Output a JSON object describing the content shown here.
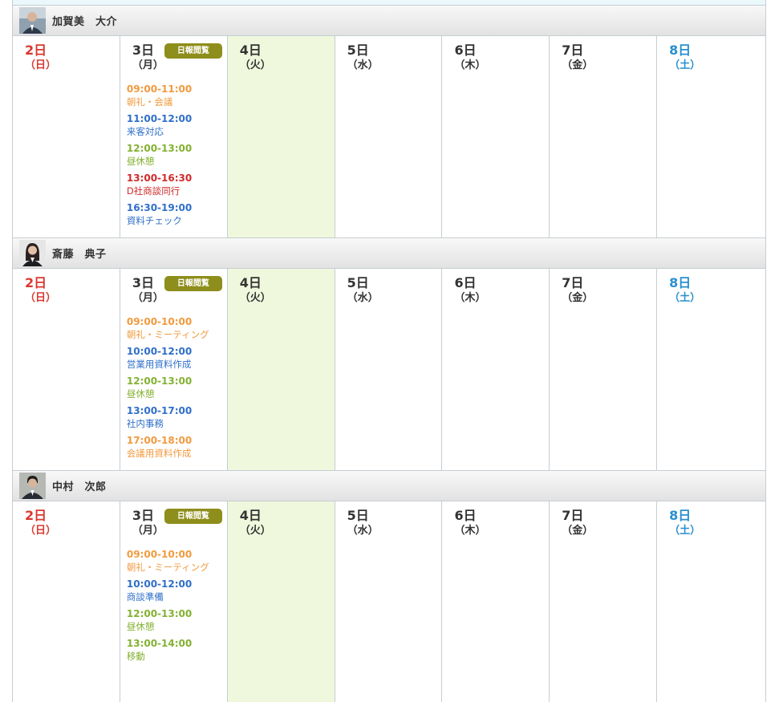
{
  "report_label": "日報閲覧",
  "colors": {
    "orange": "#f19a3e",
    "blue": "#2f6fc9",
    "green": "#84b132",
    "red": "#d12a2a",
    "today_bg": "#eff8dd",
    "sunday": "#d9382f",
    "saturday": "#2a8fcd"
  },
  "days": [
    {
      "num": "2日",
      "wd": "（日）"
    },
    {
      "num": "3日",
      "wd": "（月）"
    },
    {
      "num": "4日",
      "wd": "（火）"
    },
    {
      "num": "5日",
      "wd": "（水）"
    },
    {
      "num": "6日",
      "wd": "（木）"
    },
    {
      "num": "7日",
      "wd": "（金）"
    },
    {
      "num": "8日",
      "wd": "（土）"
    }
  ],
  "people": [
    {
      "name": "加賀美　大介",
      "events": [
        {
          "time": "09:00-11:00",
          "title": "朝礼・会議",
          "color": "orange"
        },
        {
          "time": "11:00-12:00",
          "title": "来客対応",
          "color": "blue"
        },
        {
          "time": "12:00-13:00",
          "title": "昼休憩",
          "color": "green"
        },
        {
          "time": "13:00-16:30",
          "title": "D社商談同行",
          "color": "red"
        },
        {
          "time": "16:30-19:00",
          "title": "資料チェック",
          "color": "blue"
        }
      ]
    },
    {
      "name": "斎藤　典子",
      "events": [
        {
          "time": "09:00-10:00",
          "title": "朝礼・ミーティング",
          "color": "orange"
        },
        {
          "time": "10:00-12:00",
          "title": "営業用資料作成",
          "color": "blue"
        },
        {
          "time": "12:00-13:00",
          "title": "昼休憩",
          "color": "green"
        },
        {
          "time": "13:00-17:00",
          "title": "社内事務",
          "color": "blue"
        },
        {
          "time": "17:00-18:00",
          "title": "会議用資料作成",
          "color": "orange"
        }
      ]
    },
    {
      "name": "中村　次郎",
      "events": [
        {
          "time": "09:00-10:00",
          "title": "朝礼・ミーティング",
          "color": "orange"
        },
        {
          "time": "10:00-12:00",
          "title": "商談準備",
          "color": "blue"
        },
        {
          "time": "12:00-13:00",
          "title": "昼休憩",
          "color": "green"
        },
        {
          "time": "13:00-14:00",
          "title": "移動",
          "color": "green"
        }
      ]
    }
  ]
}
